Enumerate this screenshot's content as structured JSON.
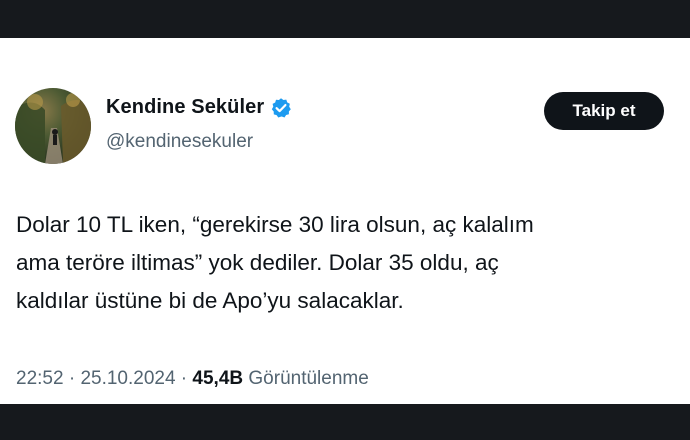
{
  "tweet": {
    "author": {
      "display_name": "Kendine Seküler",
      "handle": "@kendinesekuler",
      "verified_icon": "verified-badge-icon",
      "accent_color": "#1d9bf0"
    },
    "follow_button_label": "Takip et",
    "text_lines": [
      "Dolar 10 TL iken, “gerekirse 30 lira olsun, aç kalalım",
      "ama teröre iltimas” yok dediler. Dolar 35 oldu, aç",
      "kaldılar üstüne bi de Apo’yu salacaklar."
    ],
    "meta": {
      "time": "22:52",
      "separator": " · ",
      "date": "25.10.2024",
      "views_count": "45,4B",
      "views_label": "Görüntülenme"
    }
  }
}
